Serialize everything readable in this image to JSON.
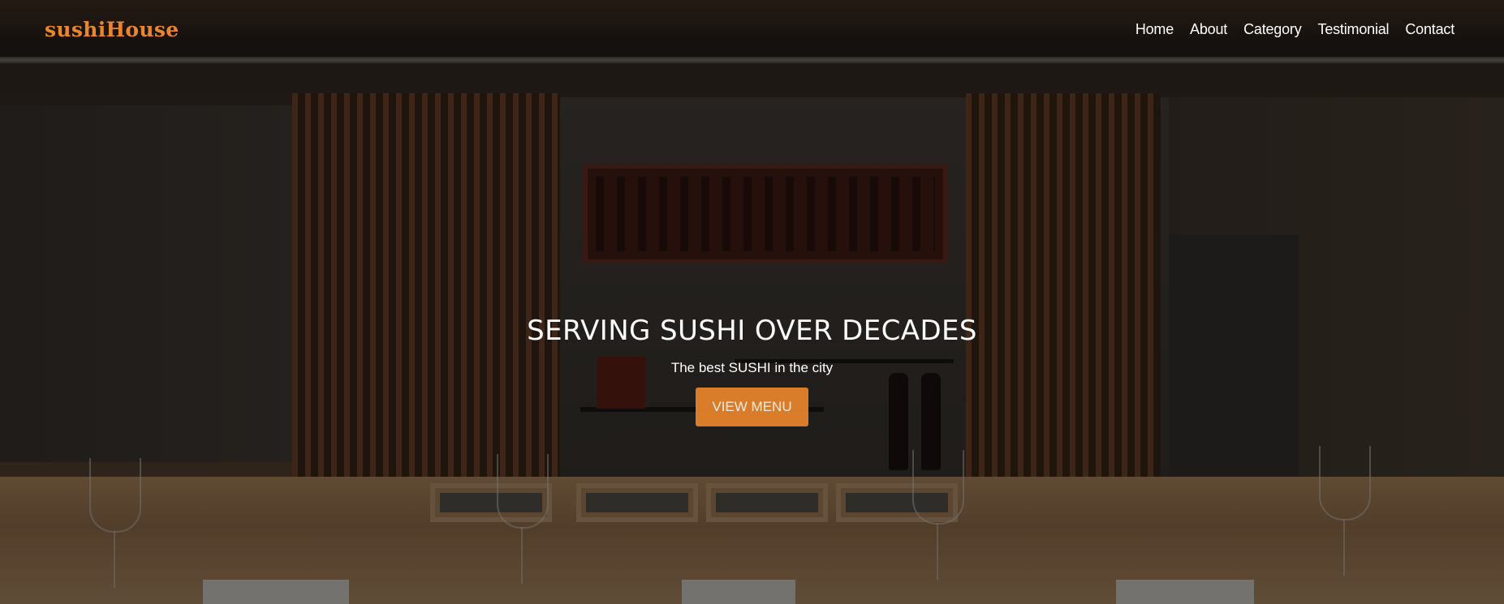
{
  "brand": {
    "name": "sushiHouse",
    "color": "#e9862c"
  },
  "nav": {
    "items": [
      {
        "label": "Home"
      },
      {
        "label": "About"
      },
      {
        "label": "Category"
      },
      {
        "label": "Testimonial"
      },
      {
        "label": "Contact"
      }
    ]
  },
  "hero": {
    "title": "SERVING SUSHI OVER DECADES",
    "subtitle": "The best SUSHI in the city",
    "button_label": "VIEW MENU",
    "button_color": "#e9862c",
    "background": "sushi-bar-interior-photo"
  }
}
